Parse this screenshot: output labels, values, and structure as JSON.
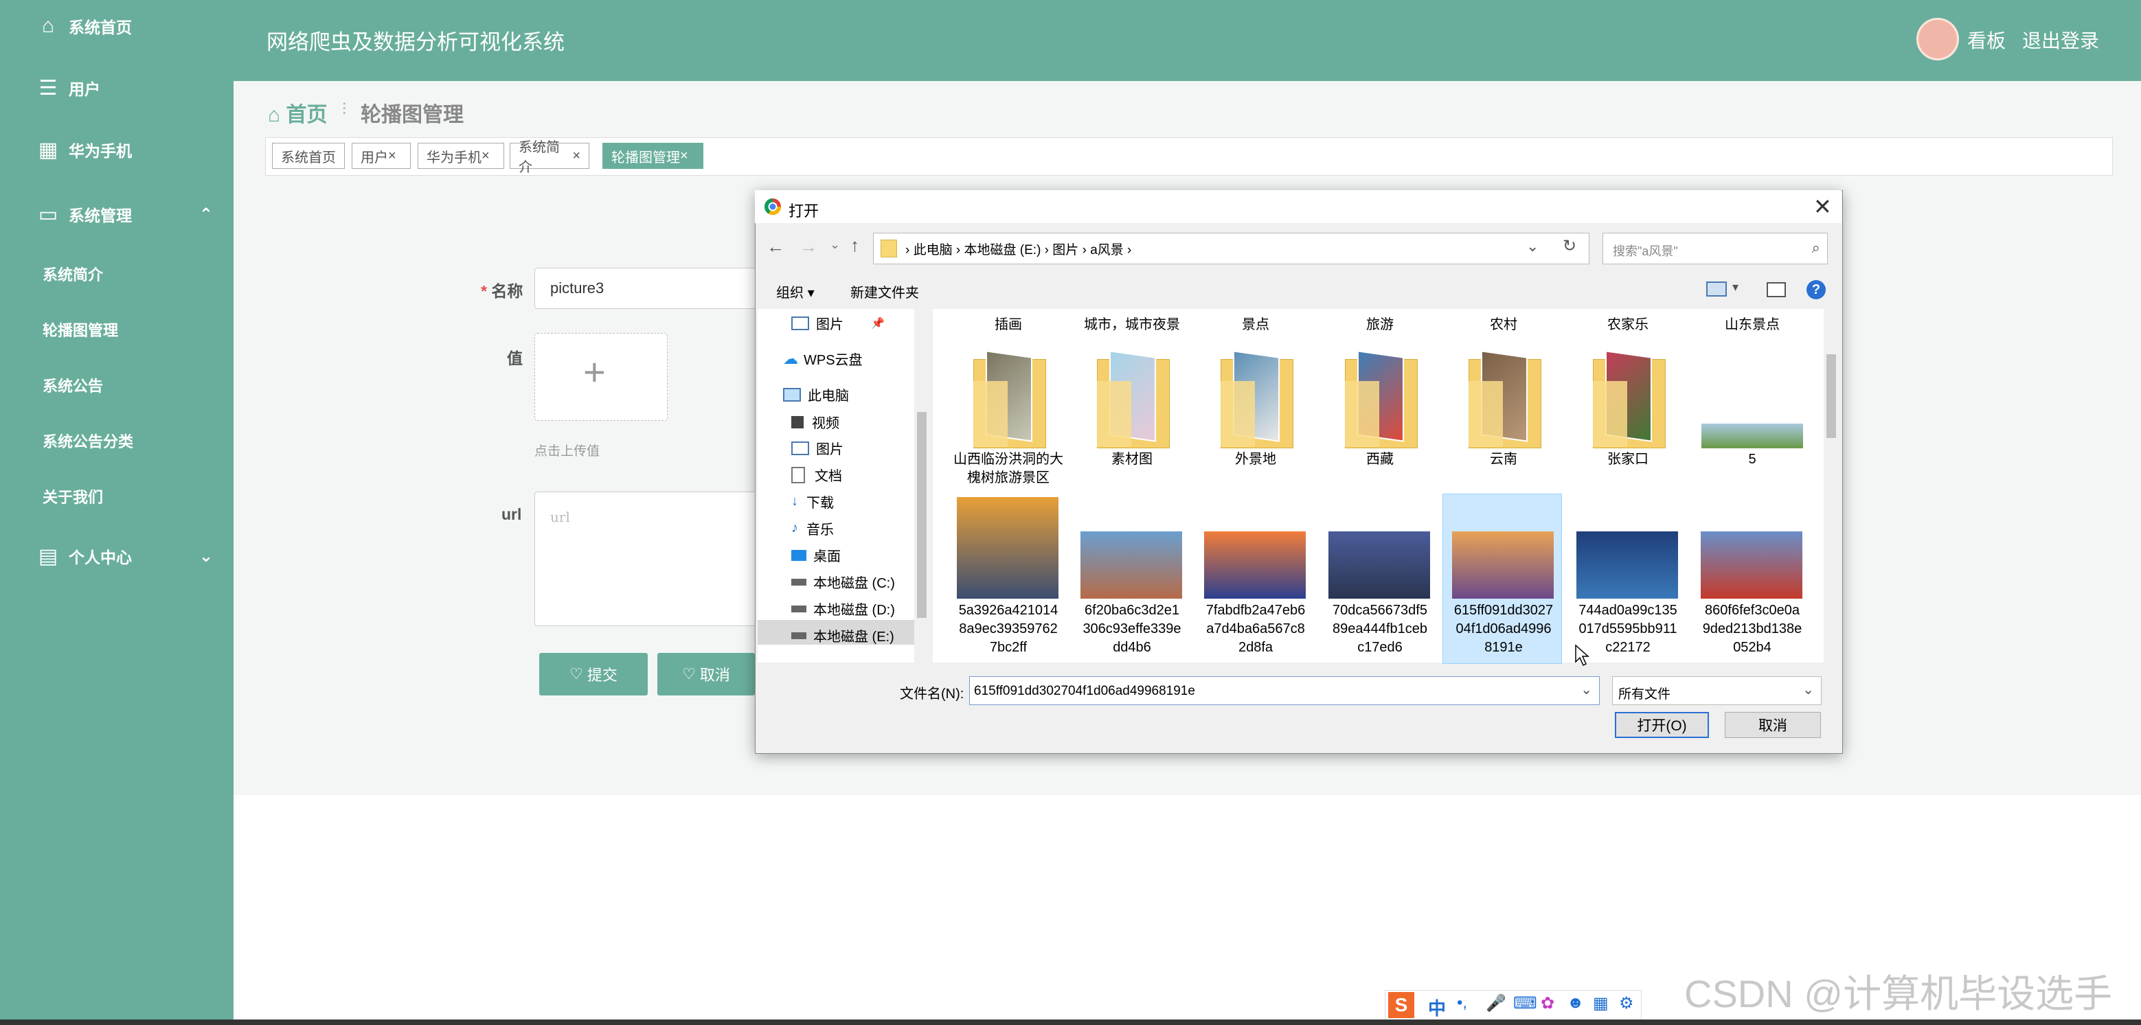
{
  "app": {
    "title": "网络爬虫及数据分析可视化系统",
    "user_board": "看板",
    "logout": "退出登录",
    "accent_color": "#69ae9c"
  },
  "sidebar": {
    "items": [
      {
        "label": "系统首页",
        "icon": "home-icon"
      },
      {
        "label": "用户",
        "icon": "list-icon"
      },
      {
        "label": "华为手机",
        "icon": "grid-icon"
      },
      {
        "label": "系统管理",
        "icon": "monitor-icon",
        "expanded": true
      },
      {
        "label": "个人中心",
        "icon": "card-icon",
        "expanded": false
      }
    ],
    "sub_items": [
      "系统简介",
      "轮播图管理",
      "系统公告",
      "系统公告分类",
      "关于我们"
    ]
  },
  "breadcrumb": {
    "home": "首页",
    "current": "轮播图管理"
  },
  "tags": [
    {
      "label": "系统首页",
      "closable": false,
      "active": false
    },
    {
      "label": "用户",
      "closable": true,
      "active": false
    },
    {
      "label": "华为手机",
      "closable": true,
      "active": false
    },
    {
      "label": "系统简介",
      "closable": true,
      "active": false
    },
    {
      "label": "轮播图管理",
      "closable": true,
      "active": true
    }
  ],
  "form": {
    "name_label": "名称",
    "name_value": "picture3",
    "value_label": "值",
    "upload_hint": "点击上传值",
    "url_label": "url",
    "url_placeholder": "url",
    "submit": "提交",
    "cancel": "取消"
  },
  "dialog": {
    "title": "打开",
    "path": [
      "此电脑",
      "本地磁盘 (E:)",
      "图片",
      "a风景"
    ],
    "search_placeholder": "搜索\"a风景\"",
    "toolbar": {
      "organize": "组织",
      "new_folder": "新建文件夹"
    },
    "nav_items": [
      {
        "label": "图片",
        "icon": "picture-icon"
      },
      {
        "label": "WPS云盘",
        "icon": "cloud-icon"
      },
      {
        "label": "此电脑",
        "icon": "computer-icon"
      },
      {
        "label": "视频",
        "icon": "video-icon"
      },
      {
        "label": "图片",
        "icon": "picture-icon"
      },
      {
        "label": "文档",
        "icon": "document-icon"
      },
      {
        "label": "下载",
        "icon": "download-icon"
      },
      {
        "label": "音乐",
        "icon": "music-icon"
      },
      {
        "label": "桌面",
        "icon": "desktop-icon"
      },
      {
        "label": "本地磁盘 (C:)",
        "icon": "drive-icon"
      },
      {
        "label": "本地磁盘 (D:)",
        "icon": "drive-icon"
      },
      {
        "label": "本地磁盘 (E:)",
        "icon": "drive-icon",
        "selected": true
      }
    ],
    "row1_labels": [
      "插画",
      "城市，城市夜景",
      "景点",
      "旅游",
      "农村",
      "农家乐",
      "山东景点"
    ],
    "row2": [
      {
        "label": "山西临汾洪洞的大槐树旅游景区",
        "kind": "folder",
        "colors": [
          "#7a7560",
          "#c9c9b8"
        ]
      },
      {
        "label": "素材图",
        "kind": "folder",
        "colors": [
          "#a6d4e8",
          "#e9c9d6"
        ]
      },
      {
        "label": "外景地",
        "kind": "folder",
        "colors": [
          "#5c8fb5",
          "#e8e8e8"
        ]
      },
      {
        "label": "西藏",
        "kind": "folder",
        "colors": [
          "#3d7fb8",
          "#e04a3a"
        ]
      },
      {
        "label": "云南",
        "kind": "folder",
        "colors": [
          "#7a6048",
          "#b99978"
        ]
      },
      {
        "label": "张家口",
        "kind": "folder",
        "colors": [
          "#c43e58",
          "#3f7a35"
        ]
      },
      {
        "label": "5",
        "kind": "image",
        "colors": [
          "#a8c8e0",
          "#6a9a48"
        ]
      }
    ],
    "row3": [
      {
        "label": "5a3926a4210148a9ec393597627bc2ff",
        "colors": [
          "#e8a038",
          "#3b4d72"
        ],
        "selected": false
      },
      {
        "label": "6f20ba6c3d2e1306c93effe339edd4b6",
        "colors": [
          "#6a9fcf",
          "#b66a48"
        ],
        "selected": false
      },
      {
        "label": "7fabdfb2a47eb6a7d4ba6a567c82d8fa",
        "colors": [
          "#f27d3a",
          "#2c3f8f"
        ],
        "selected": false
      },
      {
        "label": "70dca56673df589ea444fb1cebc17ed6",
        "colors": [
          "#4b5c9a",
          "#2a3550"
        ],
        "selected": false
      },
      {
        "label": "615ff091dd302704f1d06ad49968191e",
        "colors": [
          "#e9a255",
          "#6a4a8a"
        ],
        "selected": true
      },
      {
        "label": "744ad0a99c135017d5595bb911c22172",
        "colors": [
          "#1f3f7a",
          "#3a78b8"
        ],
        "selected": false
      },
      {
        "label": "860f6fef3c0e0a9ded213bd138e052b4",
        "colors": [
          "#6a8fc8",
          "#c53a2a"
        ],
        "selected": false
      }
    ],
    "filename_label": "文件名(N):",
    "filename_value": "615ff091dd302704f1d06ad49968191e",
    "filetype": "所有文件",
    "open_button": "打开(O)",
    "cancel_button": "取消"
  },
  "ime_bar": {
    "lang": "中"
  },
  "watermark": "CSDN @计算机毕设选手"
}
